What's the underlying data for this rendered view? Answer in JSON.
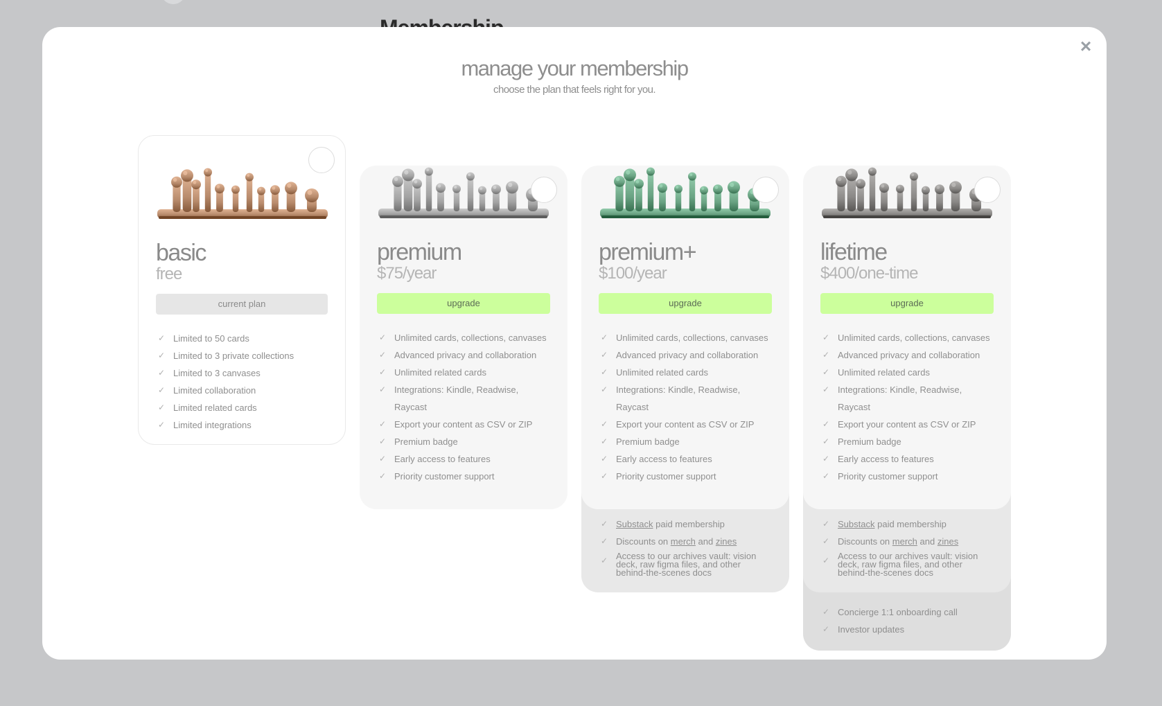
{
  "background": {
    "title": "Membership"
  },
  "modal": {
    "title": "manage your membership",
    "subtitle": "choose the plan that feels right for you.",
    "close_label": "×"
  },
  "plans": [
    {
      "name": "basic",
      "price": "free",
      "button": "current plan",
      "logo_color": "#b88b6c",
      "features": [
        "Limited to 50 cards",
        "Limited to 3 private collections",
        "Limited to 3 canvases",
        "Limited collaboration",
        "Limited related cards",
        "Limited integrations"
      ]
    },
    {
      "name": "premium",
      "price": "$75/year",
      "button": "upgrade",
      "logo_color": "#a3a3a3",
      "features": [
        "Unlimited cards, collections, canvases",
        "Advanced privacy and collaboration",
        "Unlimited related cards",
        "Integrations: Kindle, Readwise, Raycast",
        "Export your content as CSV or ZIP",
        "Premium badge",
        "Early access to features",
        "Priority customer support"
      ]
    },
    {
      "name": "premium+",
      "price": "$100/year",
      "button": "upgrade",
      "logo_color": "#6aa383",
      "features": [
        "Unlimited cards, collections, canvases",
        "Advanced privacy and collaboration",
        "Unlimited related cards",
        "Integrations: Kindle, Readwise, Raycast",
        "Export your content as CSV or ZIP",
        "Premium badge",
        "Early access to features",
        "Priority customer support"
      ],
      "extras": {
        "substack_link": "Substack",
        "substack_rest": "paid membership",
        "discounts_prefix": "Discounts on",
        "merch_link": "merch",
        "and_word": "and",
        "zines_link": "zines",
        "archives": "Access to our archives vault: vision deck, raw figma files, and other behind-the-scenes docs"
      }
    },
    {
      "name": "lifetime",
      "price": "$400/one-time",
      "button": "upgrade",
      "logo_color": "#8b8987",
      "features": [
        "Unlimited cards, collections, canvases",
        "Advanced privacy and collaboration",
        "Unlimited related cards",
        "Integrations: Kindle, Readwise, Raycast",
        "Export your content as CSV or ZIP",
        "Premium badge",
        "Early access to features",
        "Priority customer support"
      ],
      "extras": {
        "substack_link": "Substack",
        "substack_rest": "paid membership",
        "discounts_prefix": "Discounts on",
        "merch_link": "merch",
        "and_word": "and",
        "zines_link": "zines",
        "archives": "Access to our archives vault: vision deck, raw figma files, and other behind-the-scenes docs"
      },
      "extras2": [
        "Concierge 1:1 onboarding call",
        "Investor updates"
      ]
    }
  ]
}
